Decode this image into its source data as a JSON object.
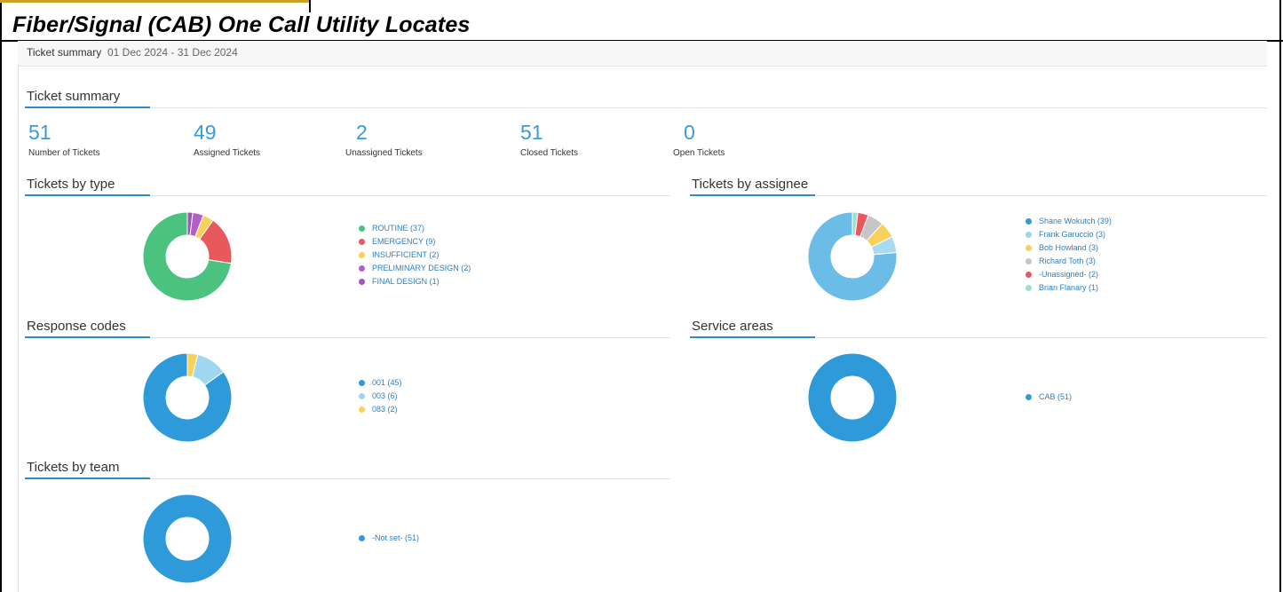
{
  "document_title": "Fiber/Signal (CAB) One Call Utility Locates",
  "summary_bar": {
    "label": "Ticket summary",
    "date_range": "01 Dec 2024 - 31 Dec 2024"
  },
  "ticket_summary": {
    "title": "Ticket summary",
    "stats": [
      {
        "value": "51",
        "label": "Number of Tickets"
      },
      {
        "value": "49",
        "label": "Assigned Tickets"
      },
      {
        "value": "2",
        "label": "Unassigned Tickets"
      },
      {
        "value": "51",
        "label": "Closed Tickets"
      },
      {
        "value": "0",
        "label": "Open Tickets"
      }
    ]
  },
  "colors": {
    "accent": "#2e8bc8",
    "stat_number": "#3a9ad9",
    "legend_text": "#2d7fc1"
  },
  "sections": {
    "by_type": {
      "title": "Tickets by type"
    },
    "by_assignee": {
      "title": "Tickets by assignee"
    },
    "response_codes": {
      "title": "Response codes"
    },
    "service_areas": {
      "title": "Service areas"
    },
    "by_team": {
      "title": "Tickets by team"
    }
  },
  "chart_data": [
    {
      "id": "by_type",
      "type": "pie",
      "style": "donut",
      "categories": [
        "ROUTINE",
        "EMERGENCY",
        "INSUFFICIENT",
        "PRELIMINARY DESIGN",
        "FINAL DESIGN"
      ],
      "values": [
        37,
        9,
        2,
        2,
        1
      ],
      "legend": [
        "ROUTINE (37)",
        "EMERGENCY (9)",
        "INSUFFICIENT (2)",
        "PRELIMINARY DESIGN (2)",
        "FINAL DESIGN (1)"
      ],
      "colors": [
        "#4cc27f",
        "#e9585c",
        "#f8d15a",
        "#b45ec9",
        "#9b59b6"
      ],
      "legend_placement": "right"
    },
    {
      "id": "by_assignee",
      "type": "pie",
      "style": "donut",
      "categories": [
        "Shane Wokutch",
        "Frank Garuccio",
        "Bob Howland",
        "Richard Toth",
        "-Unassigned-",
        "Brian Flanary"
      ],
      "values": [
        39,
        3,
        3,
        3,
        2,
        1
      ],
      "legend": [
        "Shane Wokutch (39)",
        "Frank Garuccio (3)",
        "Bob Howland (3)",
        "Richard Toth (3)",
        "-Unassigned- (2)",
        "Brian Flanary (1)"
      ],
      "colors": [
        "#6bbce6",
        "#a8daf0",
        "#f8d15a",
        "#c6c6c6",
        "#e9585c",
        "#9ee0cf"
      ],
      "legend_dot_colors": [
        "#2e9ad9",
        "#9fd4ee",
        "#f8d15a",
        "#c6c6c6",
        "#e9585c",
        "#9ee0cf"
      ],
      "legend_placement": "right"
    },
    {
      "id": "response_codes",
      "type": "pie",
      "style": "donut",
      "categories": [
        "001",
        "003",
        "083"
      ],
      "values": [
        45,
        6,
        2
      ],
      "legend": [
        "001 (45)",
        "003 (6)",
        "083 (2)"
      ],
      "colors": [
        "#2e9ad9",
        "#a1d6f1",
        "#f8d15a"
      ],
      "legend_placement": "right"
    },
    {
      "id": "service_areas",
      "type": "pie",
      "style": "donut",
      "categories": [
        "CAB"
      ],
      "values": [
        51
      ],
      "legend": [
        "CAB (51)"
      ],
      "colors": [
        "#2e9ad9"
      ],
      "legend_placement": "right"
    },
    {
      "id": "by_team",
      "type": "pie",
      "style": "donut",
      "categories": [
        "-Not set-"
      ],
      "values": [
        51
      ],
      "legend": [
        "-Not set- (51)"
      ],
      "colors": [
        "#2e9ad9"
      ],
      "legend_placement": "right"
    }
  ]
}
